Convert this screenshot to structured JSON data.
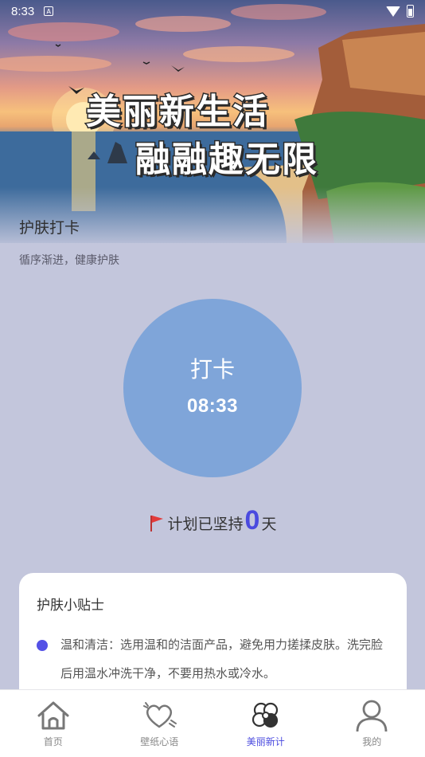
{
  "status_bar": {
    "time": "8:33",
    "notification_glyph": "A"
  },
  "hero": {
    "banner_line1": "美丽新生活",
    "banner_line2": "融融趣无限"
  },
  "page": {
    "title": "护肤打卡",
    "subtitle": "循序渐进，健康护肤"
  },
  "checkin": {
    "label": "打卡",
    "time": "08:33",
    "color": "#7fa5d9"
  },
  "streak": {
    "prefix": "计划已坚持",
    "count": "0",
    "suffix": "天",
    "accent": "#4a4adf"
  },
  "tips": {
    "title": "护肤小贴士",
    "items": [
      {
        "text": "温和清洁：选用温和的洁面产品，避免用力搓揉皮肤。洗完脸后用温水冲洗干净，不要用热水或冷水。"
      }
    ]
  },
  "nav": {
    "items": [
      {
        "label": "首页",
        "icon": "home-icon",
        "active": false
      },
      {
        "label": "壁纸心语",
        "icon": "heart-icon",
        "active": false
      },
      {
        "label": "美丽新计",
        "icon": "flower-icon",
        "active": true
      },
      {
        "label": "我的",
        "icon": "user-icon",
        "active": false
      }
    ]
  },
  "colors": {
    "background": "#c3c6dc",
    "active_nav": "#4a4adf",
    "tip_dot": "#5451e6"
  }
}
